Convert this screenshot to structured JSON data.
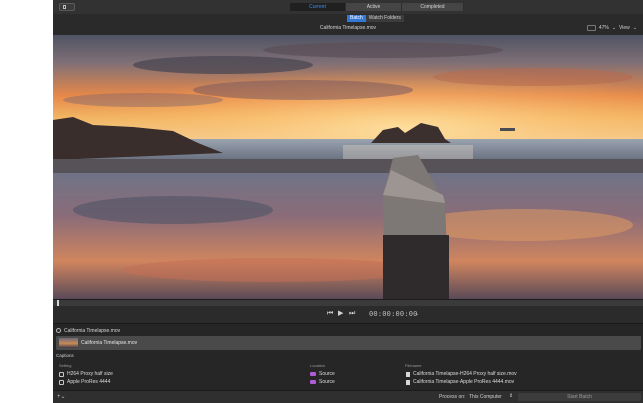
{
  "toolbar": {
    "tabs": [
      {
        "label": "Current",
        "selected": true
      },
      {
        "label": "Active",
        "selected": false
      },
      {
        "label": "Completed",
        "selected": false
      }
    ]
  },
  "subheader": {
    "batch_tab": "Batch",
    "watch_folders_tab": "Watch Folders",
    "file_title": "California Timelapse.mov",
    "zoom": "47%",
    "view_menu": "View"
  },
  "transport": {
    "timecode": "00:00:00:00",
    "icons": [
      "skip-back-icon",
      "play-icon",
      "skip-forward-icon"
    ]
  },
  "batch": {
    "source_header": "California Timelapse.mov",
    "source_name": "California Timelapse.mov",
    "captions_label": "Captions",
    "columns": {
      "setting": "Setting",
      "location": "Location",
      "filename": "Filename"
    },
    "rows": [
      {
        "setting": "H264 Proxy half size",
        "location": "Source",
        "filename": "California Timelapse-H264 Proxy half size.mov"
      },
      {
        "setting": "Apple ProRes 4444",
        "location": "Source",
        "filename": "California Timelapse-Apple ProRes 4444.mov"
      }
    ]
  },
  "footer": {
    "process_on_label": "Process on:",
    "process_on_value": "This Computer",
    "start_batch": "Start Batch"
  },
  "colors": {
    "accent": "#3478d6",
    "selected_tab_text": "#3f8fe6",
    "location_folder": "#b05cd6",
    "window_bg": "#2b2b2b"
  }
}
